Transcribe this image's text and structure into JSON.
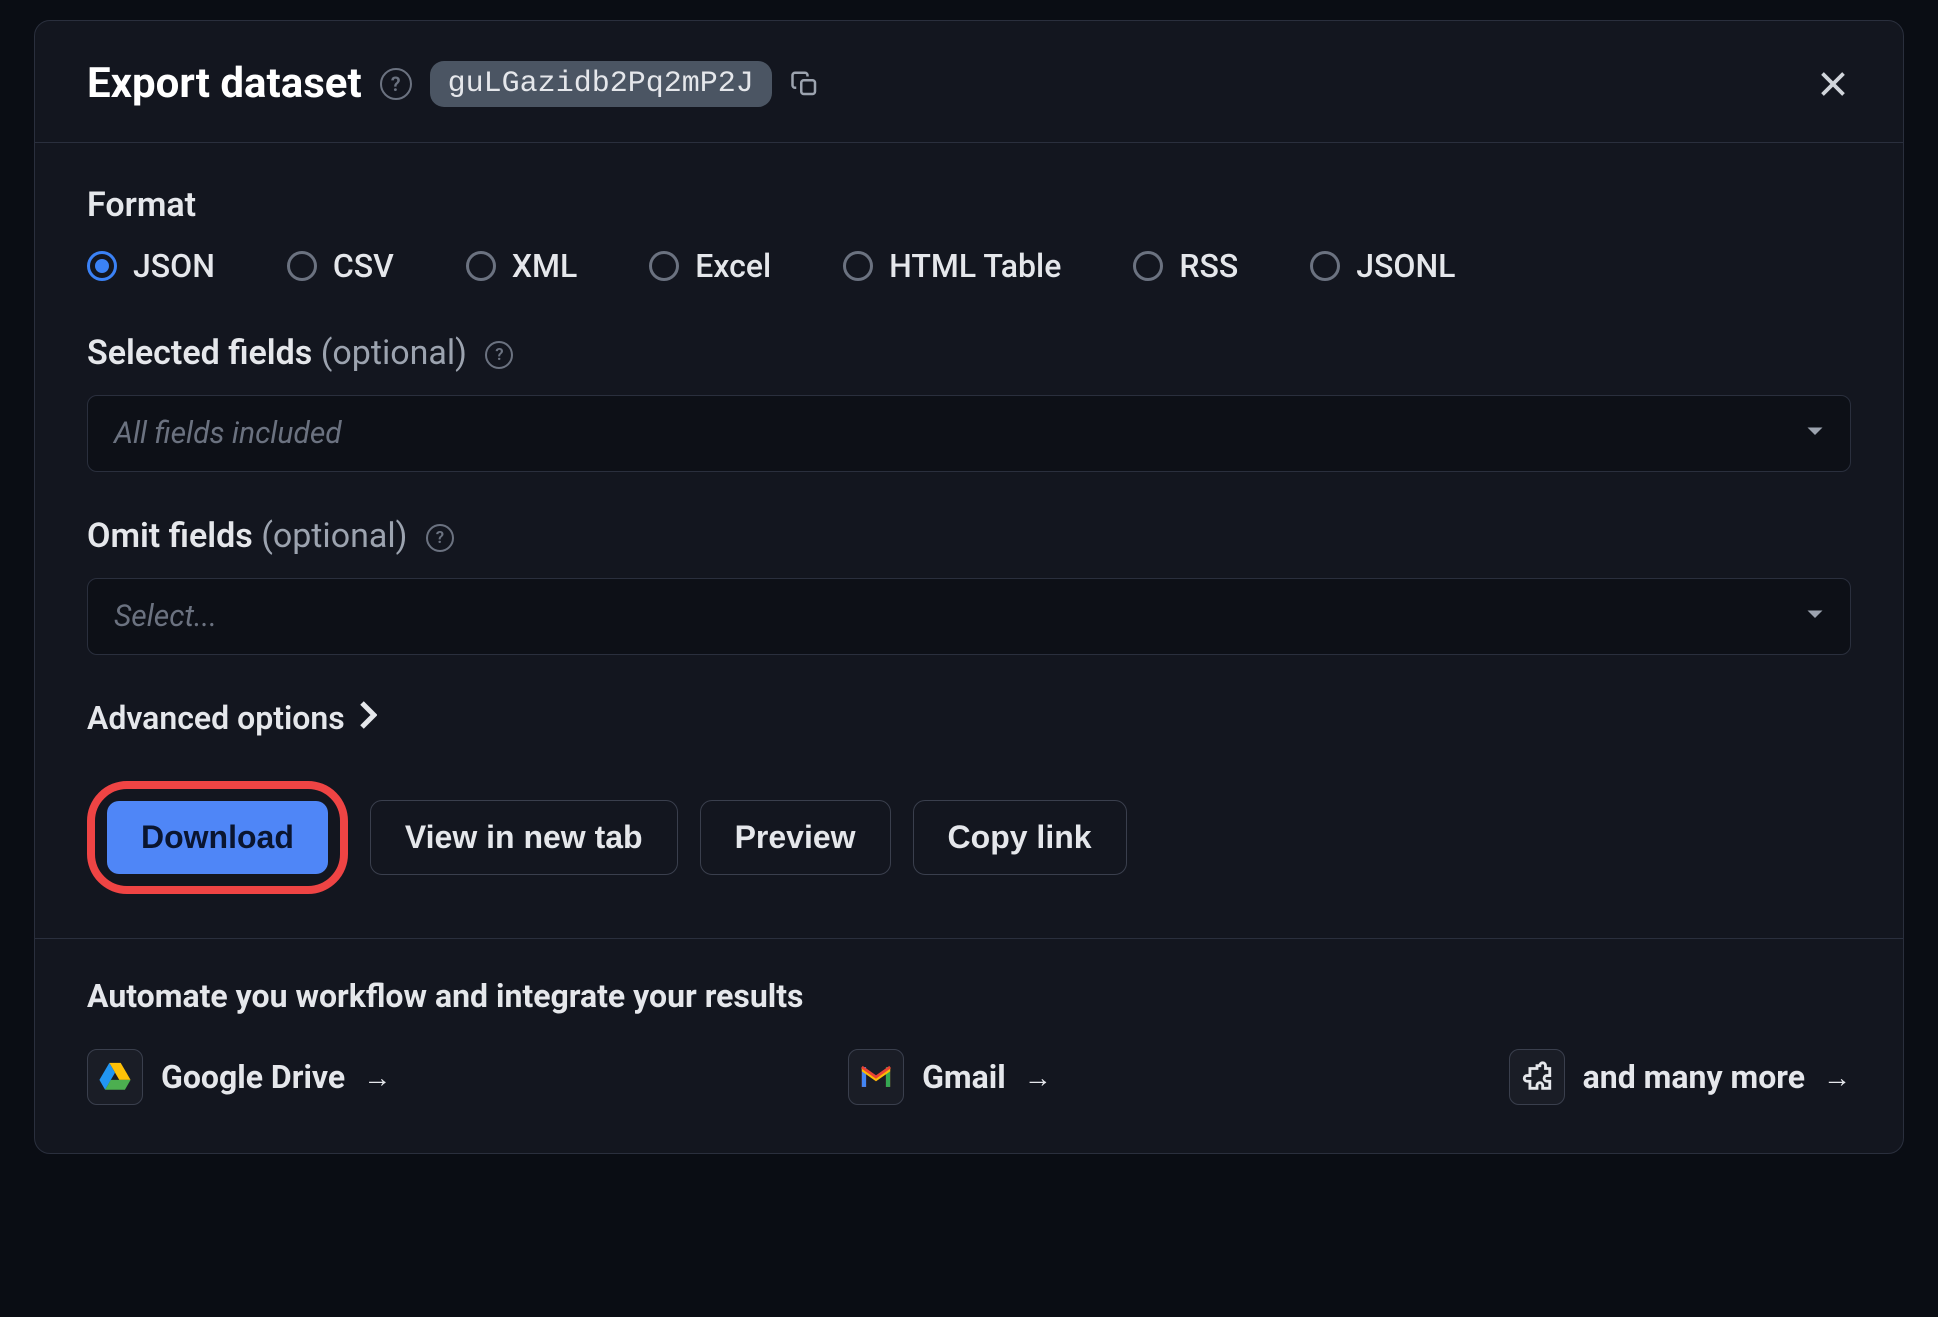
{
  "header": {
    "title": "Export dataset",
    "dataset_id": "guLGazidb2Pq2mP2J"
  },
  "format": {
    "label": "Format",
    "options": [
      "JSON",
      "CSV",
      "XML",
      "Excel",
      "HTML Table",
      "RSS",
      "JSONL"
    ],
    "selected": "JSON"
  },
  "selected_fields": {
    "label": "Selected fields",
    "optional_text": "(optional)",
    "placeholder": "All fields included"
  },
  "omit_fields": {
    "label": "Omit fields",
    "optional_text": "(optional)",
    "placeholder": "Select..."
  },
  "advanced": {
    "label": "Advanced options"
  },
  "actions": {
    "download": "Download",
    "view_new_tab": "View in new tab",
    "preview": "Preview",
    "copy_link": "Copy link"
  },
  "footer": {
    "title": "Automate you workflow and integrate your results",
    "integrations": {
      "gdrive": "Google Drive",
      "gmail": "Gmail",
      "more": "and many more"
    }
  }
}
